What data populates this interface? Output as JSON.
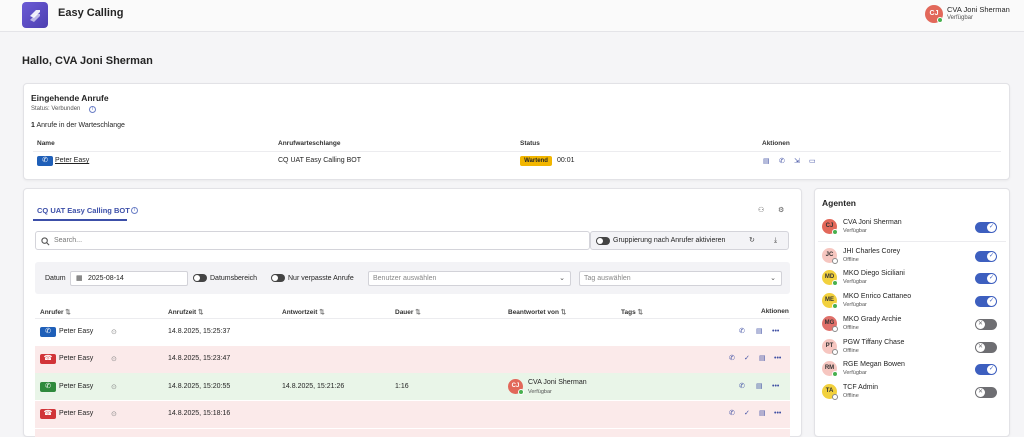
{
  "app": {
    "title": "Easy Calling"
  },
  "user": {
    "initials": "CJ",
    "name": "CVA Joni Sherman",
    "status": "Verfügbar"
  },
  "greeting": "Hallo, CVA Joni Sherman",
  "incoming": {
    "title": "Eingehende Anrufe",
    "status": "Status: Verbunden",
    "queue_count": "1",
    "queue_text": "Anrufe in der Warteschlange",
    "columns": [
      "Name",
      "Anrufwarteschlange",
      "Status",
      "Aktionen"
    ],
    "row": {
      "name": "Peter Easy",
      "queue": "CQ UAT Easy Calling BOT",
      "status_badge": "Wartend",
      "timer": "00:01"
    }
  },
  "history": {
    "tab": "CQ UAT Easy Calling BOT",
    "search_placeholder": "Search...",
    "group_toggle_label": "Gruppierung nach Anrufer aktivieren",
    "filters": {
      "date_label": "Datum",
      "date_value": "2025-08-14",
      "date_range_label": "Datumsbereich",
      "missed_only_label": "Nur verpasste Anrufe",
      "user_placeholder": "Benutzer auswählen",
      "tag_placeholder": "Tag auswählen"
    },
    "columns": [
      "Anrufer",
      "Anrufzeit",
      "Antwortzeit",
      "Dauer",
      "Beantwortet von",
      "Tags",
      "Aktionen"
    ],
    "rows": [
      {
        "caller": "Peter Easy",
        "call_time": "14.8.2025, 15:25:37",
        "answer_time": "",
        "duration": "",
        "answered_by": "",
        "answered_status": "",
        "initials": ""
      },
      {
        "caller": "Peter Easy",
        "call_time": "14.8.2025, 15:23:47",
        "answer_time": "",
        "duration": "",
        "answered_by": "",
        "answered_status": "",
        "initials": ""
      },
      {
        "caller": "Peter Easy",
        "call_time": "14.8.2025, 15:20:55",
        "answer_time": "14.8.2025, 15:21:26",
        "duration": "1:16",
        "answered_by": "CVA Joni Sherman",
        "answered_status": "Verfügbar",
        "initials": "CJ"
      },
      {
        "caller": "Peter Easy",
        "call_time": "14.8.2025, 15:18:16",
        "answer_time": "",
        "duration": "",
        "answered_by": "",
        "answered_status": "",
        "initials": ""
      }
    ]
  },
  "agents": {
    "title": "Agenten",
    "list": [
      {
        "initials": "CJ",
        "name": "CVA Joni Sherman",
        "status": "Verfügbar",
        "enabled": true
      },
      {
        "initials": "JC",
        "name": "JHI Charles Corey",
        "status": "Offline",
        "enabled": true
      },
      {
        "initials": "MD",
        "name": "MKO Diego Siciliani",
        "status": "Verfügbar",
        "enabled": true
      },
      {
        "initials": "ME",
        "name": "MKO Enrico Cattaneo",
        "status": "Verfügbar",
        "enabled": true
      },
      {
        "initials": "MG",
        "name": "MKO Grady Archie",
        "status": "Offline",
        "enabled": false
      },
      {
        "initials": "PT",
        "name": "PGW Tiffany Chase",
        "status": "Offline",
        "enabled": false
      },
      {
        "initials": "RM",
        "name": "RGE Megan Bowen",
        "status": "Verfügbar",
        "enabled": true
      },
      {
        "initials": "TA",
        "name": "TCF Admin",
        "status": "Offline",
        "enabled": false
      }
    ]
  },
  "colors": {
    "accent": "#3d5fbf",
    "waiting": "#f2b600",
    "missed_row": "#fbeaea",
    "answered_row": "#e9f5e8"
  }
}
